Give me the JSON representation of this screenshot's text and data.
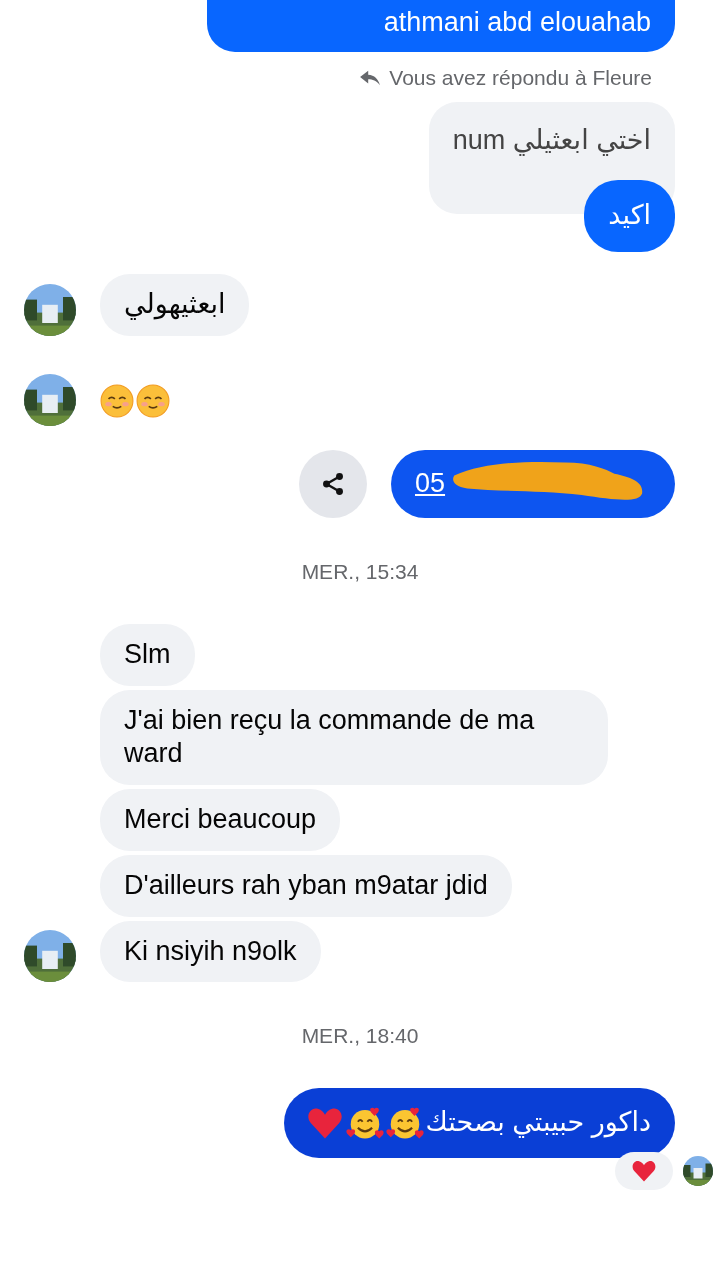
{
  "messages": [
    {
      "kind": "outgoing",
      "text": "athmani abd elouahab"
    },
    {
      "kind": "reply_note",
      "text": "Vous avez répondu à Fleure"
    },
    {
      "kind": "outgoing",
      "quote": "اختي ابعثيلي num",
      "text": "اكيد"
    },
    {
      "kind": "incoming",
      "text": "ابعثيهولي",
      "avatar": true
    },
    {
      "kind": "incoming_emoji",
      "icons": [
        {
          "kind": "smiling"
        },
        {
          "kind": "smiling"
        }
      ],
      "avatar": true
    },
    {
      "kind": "outgoing_link",
      "text": "05",
      "redacted": true,
      "share": true
    },
    {
      "kind": "timestamp",
      "text": "MER., 15:34"
    },
    {
      "kind": "incoming",
      "text": "Slm",
      "avatar": false
    },
    {
      "kind": "incoming",
      "text": "J'ai bien reçu la commande de ma ward",
      "avatar": false
    },
    {
      "kind": "incoming",
      "text": "Merci beaucoup",
      "avatar": false
    },
    {
      "kind": "incoming",
      "text": "D'ailleurs rah yban m9atar jdid",
      "avatar": false
    },
    {
      "kind": "incoming",
      "text": "Ki nsiyih n9olk",
      "avatar": true
    },
    {
      "kind": "timestamp",
      "text": "MER., 18:40"
    },
    {
      "kind": "outgoing",
      "text": "داكور حبيبتي بصحتك",
      "icons": [
        {
          "kind": "hearts_face"
        },
        {
          "kind": "hearts_face"
        },
        {
          "kind": "heart"
        }
      ],
      "reaction": {
        "kind": "heart"
      },
      "seen": true
    }
  ]
}
